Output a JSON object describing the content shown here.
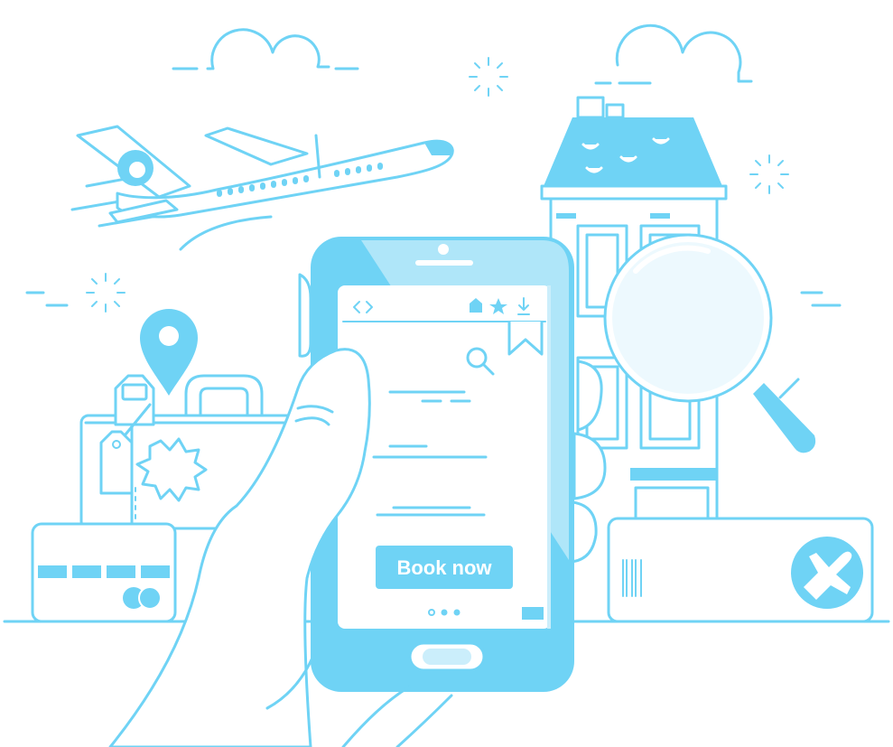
{
  "illustration": {
    "book_button_label": "Book now",
    "accent_color": "#6fd3f5",
    "fill_light": "#cbeefb",
    "background_color": "#ffffff",
    "icons": [
      "cloud-icon",
      "sparkle-icon",
      "airplane-icon",
      "location-pin-icon",
      "suitcase-icon",
      "luggage-tag-icon",
      "credit-card-icon",
      "hotel-building-icon",
      "magnifying-glass-icon",
      "smartphone-icon",
      "home-icon",
      "star-icon",
      "download-icon",
      "bookmark-icon",
      "search-icon",
      "boarding-pass-icon",
      "airplane-circle-icon",
      "hand-icon"
    ]
  }
}
